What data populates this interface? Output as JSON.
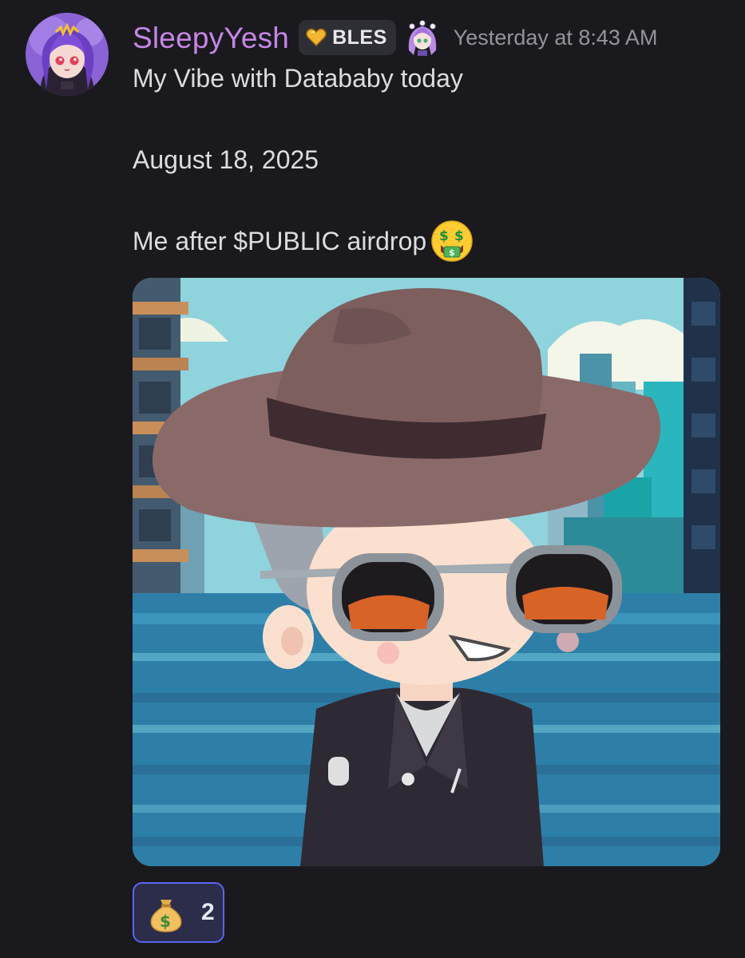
{
  "message": {
    "author": {
      "username": "SleepyYesh",
      "name_color": "#c586e6",
      "avatar": "anime-girl-avatar",
      "guild_tag": {
        "icon": "heart-icon",
        "text": "BLES"
      },
      "role_icon": "chibi-girl-icon"
    },
    "timestamp": "Yesterday at 8:43 AM",
    "lines": [
      "My Vibe with Datababy today",
      "August 18, 2025",
      "Me after $PUBLIC airdrop"
    ],
    "inline_emoji": "money-mouth-face-emoji",
    "attachment": {
      "type": "image",
      "description_icon": "pixel-art-avatar-image"
    },
    "reactions": [
      {
        "emoji": "money-bag-emoji",
        "count": "2",
        "selected": true
      }
    ]
  },
  "colors": {
    "background": "#1a1a1e",
    "text": "#dcdde1",
    "timestamp": "#94959c",
    "reaction_border": "#5865f2"
  }
}
